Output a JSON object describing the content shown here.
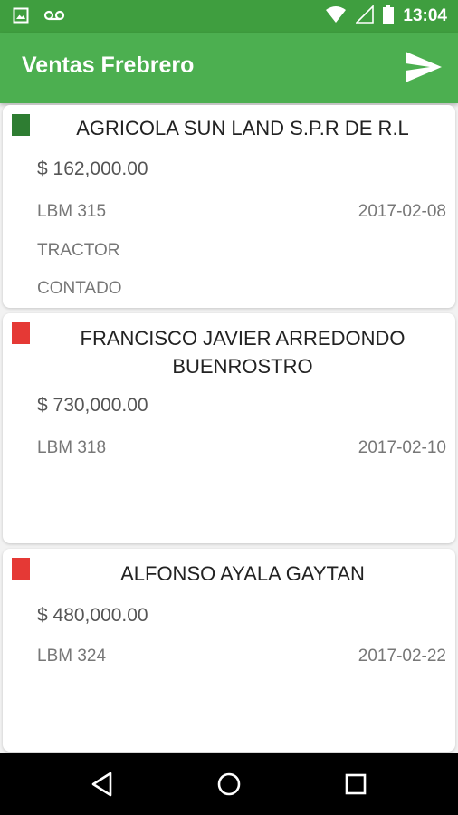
{
  "status_bar": {
    "time": "13:04"
  },
  "app_bar": {
    "title": "Ventas Frebrero",
    "send_icon": "send-icon"
  },
  "colors": {
    "green_marker": "#2e7d32",
    "red_marker": "#e53935",
    "app_bar": "#4caf50",
    "status_bar": "#3f9e3f"
  },
  "sales": [
    {
      "client": "AGRICOLA SUN LAND S.P.R DE R.L",
      "amount": "$ 162,000.00",
      "code": "LBM 315",
      "date": "2017-02-08",
      "product": "TRACTOR",
      "payment": "CONTADO",
      "marker": "green"
    },
    {
      "client": "FRANCISCO JAVIER ARREDONDO BUENROSTRO",
      "amount": "$ 730,000.00",
      "code": "LBM 318",
      "date": "2017-02-10",
      "product": "",
      "payment": "",
      "marker": "red"
    },
    {
      "client": "ALFONSO AYALA GAYTAN",
      "amount": "$ 480,000.00",
      "code": "LBM 324",
      "date": "2017-02-22",
      "product": "",
      "payment": "",
      "marker": "red"
    }
  ]
}
